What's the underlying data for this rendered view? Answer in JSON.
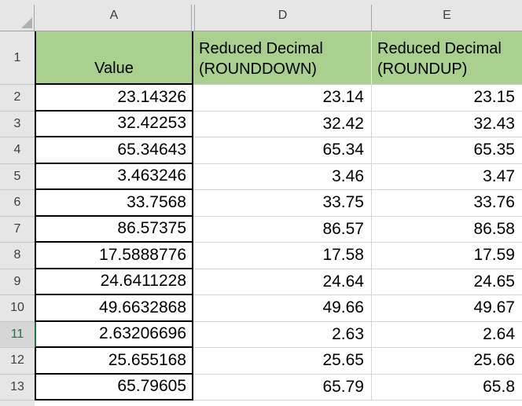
{
  "colors": {
    "header_fill_green": "#a9d08e",
    "selection_green": "#217346",
    "heading_gray": "#e6e6e6",
    "selected_heading_gray": "#d6d6d6",
    "gridline_gray": "#d4d4d4",
    "table_border_black": "#000000"
  },
  "sheet": {
    "column_headers": [
      "A",
      "D",
      "E"
    ],
    "selected_row": "11",
    "selected_cell": "A11",
    "header_row": {
      "number": "1",
      "value_label": "Value",
      "rounddown_line1": "Reduced Decimal",
      "rounddown_line2": "(ROUNDDOWN)",
      "roundup_line1": "Reduced Decimal",
      "roundup_line2": "(ROUNDUP)"
    },
    "rows": [
      {
        "number": "2",
        "value": "23.14326",
        "rounddown": "23.14",
        "roundup": "23.15"
      },
      {
        "number": "3",
        "value": "32.42253",
        "rounddown": "32.42",
        "roundup": "32.43"
      },
      {
        "number": "4",
        "value": "65.34643",
        "rounddown": "65.34",
        "roundup": "65.35"
      },
      {
        "number": "5",
        "value": "3.463246",
        "rounddown": "3.46",
        "roundup": "3.47"
      },
      {
        "number": "6",
        "value": "33.7568",
        "rounddown": "33.75",
        "roundup": "33.76"
      },
      {
        "number": "7",
        "value": "86.57375",
        "rounddown": "86.57",
        "roundup": "86.58"
      },
      {
        "number": "8",
        "value": "17.5888776",
        "rounddown": "17.58",
        "roundup": "17.59"
      },
      {
        "number": "9",
        "value": "24.6411228",
        "rounddown": "24.64",
        "roundup": "24.65"
      },
      {
        "number": "10",
        "value": "49.6632868",
        "rounddown": "49.66",
        "roundup": "49.67"
      },
      {
        "number": "11",
        "value": "2.63206696",
        "rounddown": "2.63",
        "roundup": "2.64"
      },
      {
        "number": "12",
        "value": "25.655168",
        "rounddown": "25.65",
        "roundup": "25.66"
      },
      {
        "number": "13",
        "value": "65.79605",
        "rounddown": "65.79",
        "roundup": "65.8"
      }
    ]
  }
}
